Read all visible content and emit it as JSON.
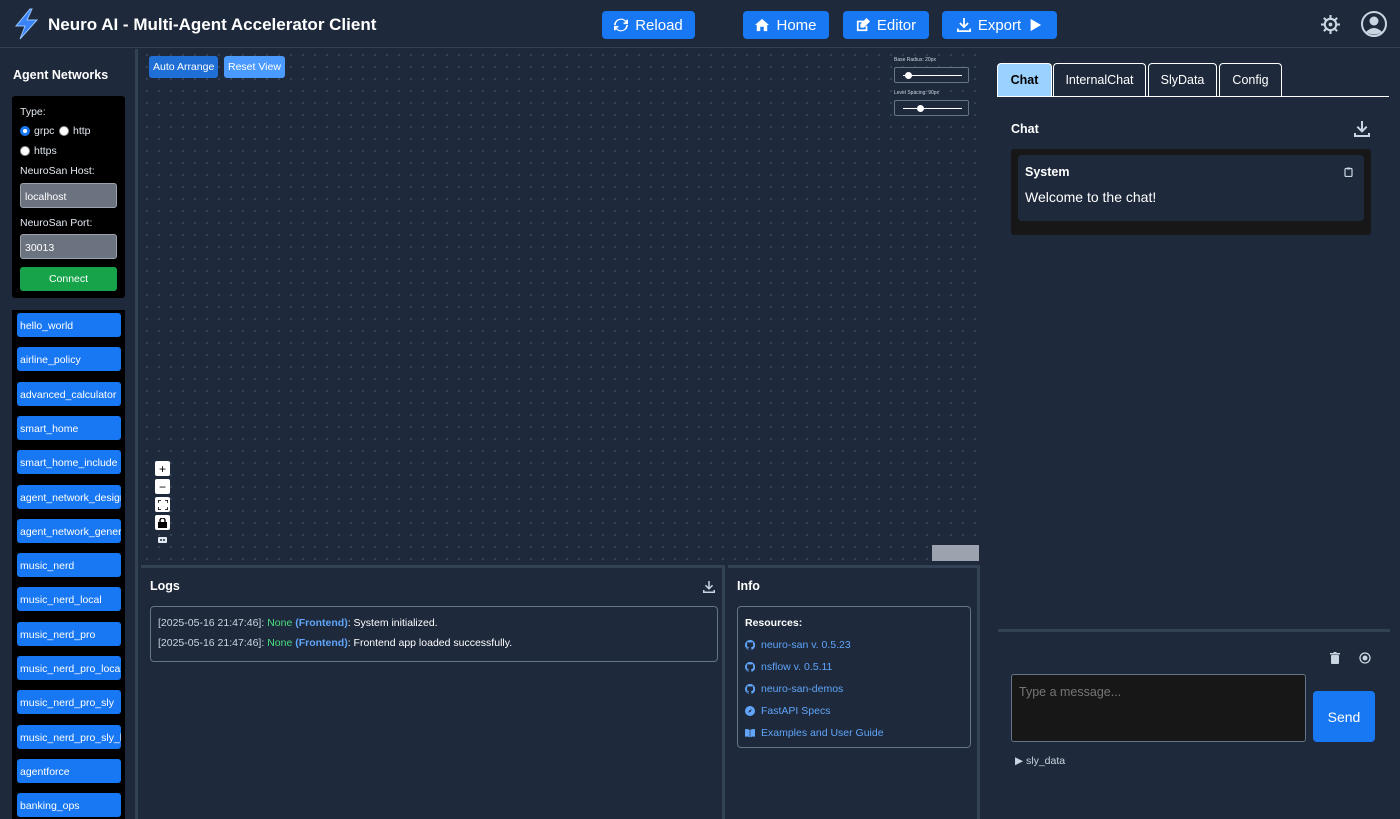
{
  "app": {
    "title": "Neuro AI - Multi-Agent Accelerator Client"
  },
  "header": {
    "reload": "Reload",
    "home": "Home",
    "editor": "Editor",
    "export": "Export"
  },
  "sidebar": {
    "title": "Agent Networks",
    "type_label": "Type:",
    "types": [
      "grpc",
      "http",
      "https"
    ],
    "selected_type": "grpc",
    "host_label": "NeuroSan Host:",
    "host_value": "localhost",
    "port_label": "NeuroSan Port:",
    "port_value": "30013",
    "connect": "Connect",
    "networks": [
      "hello_world",
      "airline_policy",
      "advanced_calculator",
      "smart_home",
      "smart_home_include",
      "agent_network_designer",
      "agent_network_generator",
      "music_nerd",
      "music_nerd_local",
      "music_nerd_pro",
      "music_nerd_pro_local",
      "music_nerd_pro_sly",
      "music_nerd_pro_sly_local",
      "agentforce",
      "banking_ops"
    ]
  },
  "canvas": {
    "auto_arrange": "Auto Arrange",
    "reset_view": "Reset View",
    "base_radius_label": "Base Radius: 20px",
    "level_spacing_label": "Level Spacing: 90px",
    "base_radius_pos": 0.08,
    "level_spacing_pos": 0.28
  },
  "logs": {
    "title": "Logs",
    "entries": [
      {
        "ts": "[2025-05-16 21:47:46]:",
        "level": "None",
        "source": "(Frontend)",
        "msg": ": System initialized."
      },
      {
        "ts": "[2025-05-16 21:47:46]:",
        "level": "None",
        "source": "(Frontend)",
        "msg": ": Frontend app loaded successfully."
      }
    ]
  },
  "info": {
    "title": "Info",
    "resources_title": "Resources:",
    "links": [
      {
        "icon": "github-icon",
        "label": "neuro-san v. 0.5.23"
      },
      {
        "icon": "github-icon",
        "label": "nsflow v. 0.5.11"
      },
      {
        "icon": "github-icon",
        "label": "neuro-san-demos"
      },
      {
        "icon": "compass-icon",
        "label": "FastAPI Specs"
      },
      {
        "icon": "book-icon",
        "label": "Examples and User Guide"
      }
    ]
  },
  "chat": {
    "tabs": [
      "Chat",
      "InternalChat",
      "SlyData",
      "Config"
    ],
    "active_tab": "Chat",
    "title": "Chat",
    "messages": [
      {
        "sender": "System",
        "text": "Welcome to the chat!"
      }
    ],
    "input_placeholder": "Type a message...",
    "send": "Send",
    "sly_data": "▶ sly_data"
  },
  "colors": {
    "primary": "#1877f2",
    "success": "#16a34a",
    "background": "#1e293b",
    "active_tab": "#9bd1ff"
  }
}
